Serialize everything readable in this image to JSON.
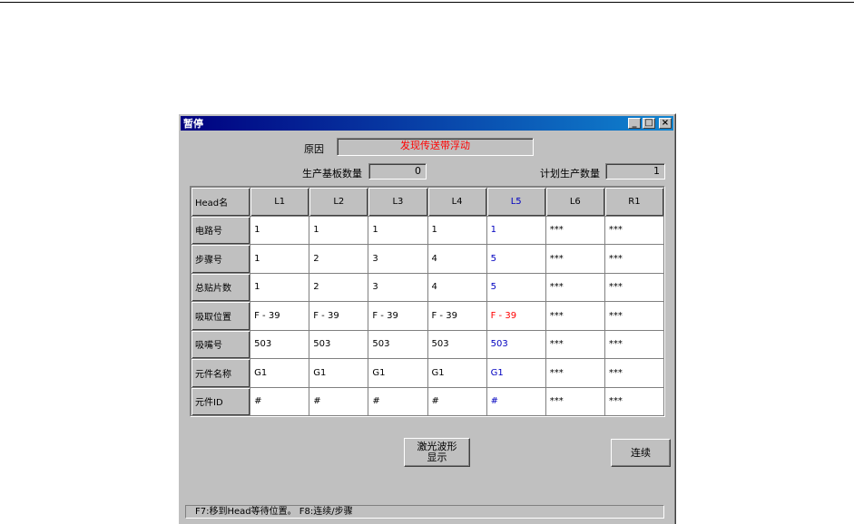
{
  "window": {
    "title": "暂停"
  },
  "reason": {
    "label": "原因",
    "value": "发现传送带浮动"
  },
  "production": {
    "count_label": "生产基板数量",
    "count_value": "0",
    "plan_label": "计划生产数量",
    "plan_value": "1"
  },
  "table": {
    "corner": "Head名",
    "columns": [
      "L1",
      "L2",
      "L3",
      "L4",
      "L5",
      "L6",
      "R1"
    ],
    "rows": [
      {
        "label": "电路号",
        "cells": [
          "1",
          "1",
          "1",
          "1",
          "1",
          "***",
          "***"
        ]
      },
      {
        "label": "步骤号",
        "cells": [
          "1",
          "2",
          "3",
          "4",
          "5",
          "***",
          "***"
        ]
      },
      {
        "label": "总贴片数",
        "cells": [
          "1",
          "2",
          "3",
          "4",
          "5",
          "***",
          "***"
        ]
      },
      {
        "label": "吸取位置",
        "cells": [
          "F - 39",
          "F - 39",
          "F - 39",
          "F - 39",
          "F - 39",
          "***",
          "***"
        ]
      },
      {
        "label": "吸嘴号",
        "cells": [
          "503",
          "503",
          "503",
          "503",
          "503",
          "***",
          "***"
        ]
      },
      {
        "label": "元件名称",
        "cells": [
          "G1",
          "G1",
          "G1",
          "G1",
          "G1",
          "***",
          "***"
        ]
      },
      {
        "label": "元件ID",
        "cells": [
          "#",
          "#",
          "#",
          "#",
          "#",
          "***",
          "***"
        ]
      }
    ]
  },
  "buttons": {
    "laser_line1": "激光波形",
    "laser_line2": "显示",
    "continue": "连续"
  },
  "status": "F7:移到Head等待位置。  F8:连续/步骤",
  "colors": {
    "titlebar": "#000080",
    "highlight_blue": "#0000c0",
    "alert_red": "#ff0000"
  }
}
